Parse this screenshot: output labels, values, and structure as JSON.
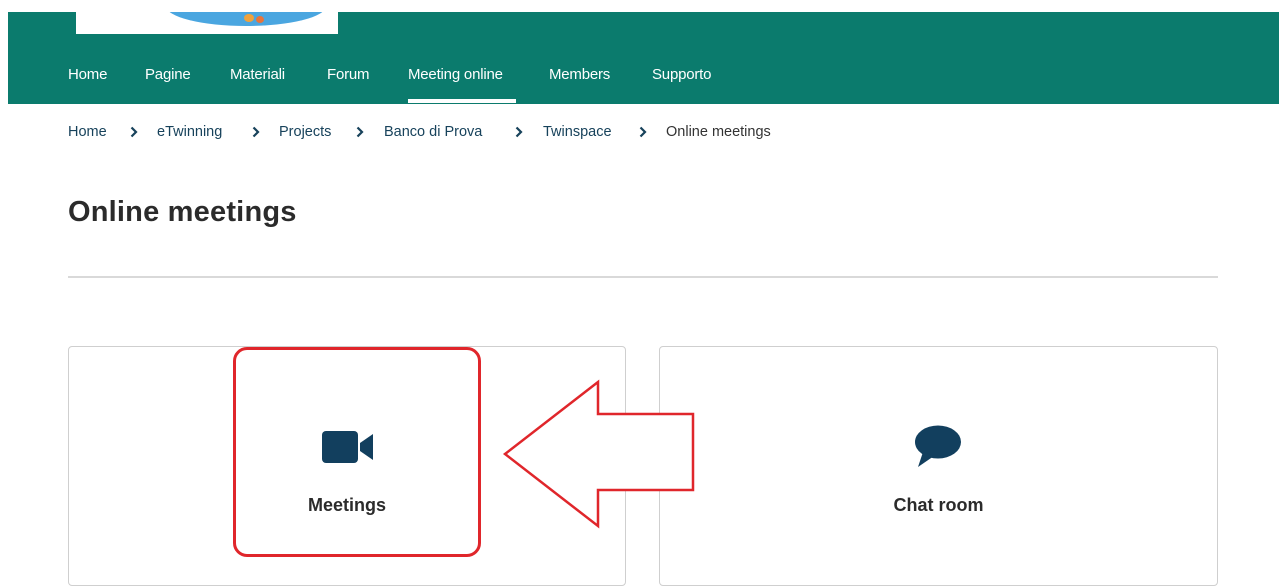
{
  "nav": {
    "items": [
      {
        "label": "Home"
      },
      {
        "label": "Pagine"
      },
      {
        "label": "Materiali"
      },
      {
        "label": "Forum"
      },
      {
        "label": "Meeting online"
      },
      {
        "label": "Members"
      },
      {
        "label": "Supporto"
      }
    ],
    "active": "Meeting online",
    "background": "#0b7b6d"
  },
  "breadcrumb": [
    {
      "label": "Home"
    },
    {
      "label": "eTwinning"
    },
    {
      "label": "Projects"
    },
    {
      "label": "Banco di Prova"
    },
    {
      "label": "Twinspace"
    },
    {
      "label": "Online meetings"
    }
  ],
  "page": {
    "title": "Online meetings"
  },
  "cards": [
    {
      "label": "Meetings",
      "icon": "video-camera-icon"
    },
    {
      "label": "Chat room",
      "icon": "speech-bubble-icon"
    }
  ],
  "annotation": {
    "color": "#e0262b",
    "highlight": "Meetings",
    "arrow": "left-arrow-outline"
  },
  "colors": {
    "icon": "#123f5e",
    "link": "#17425b"
  }
}
